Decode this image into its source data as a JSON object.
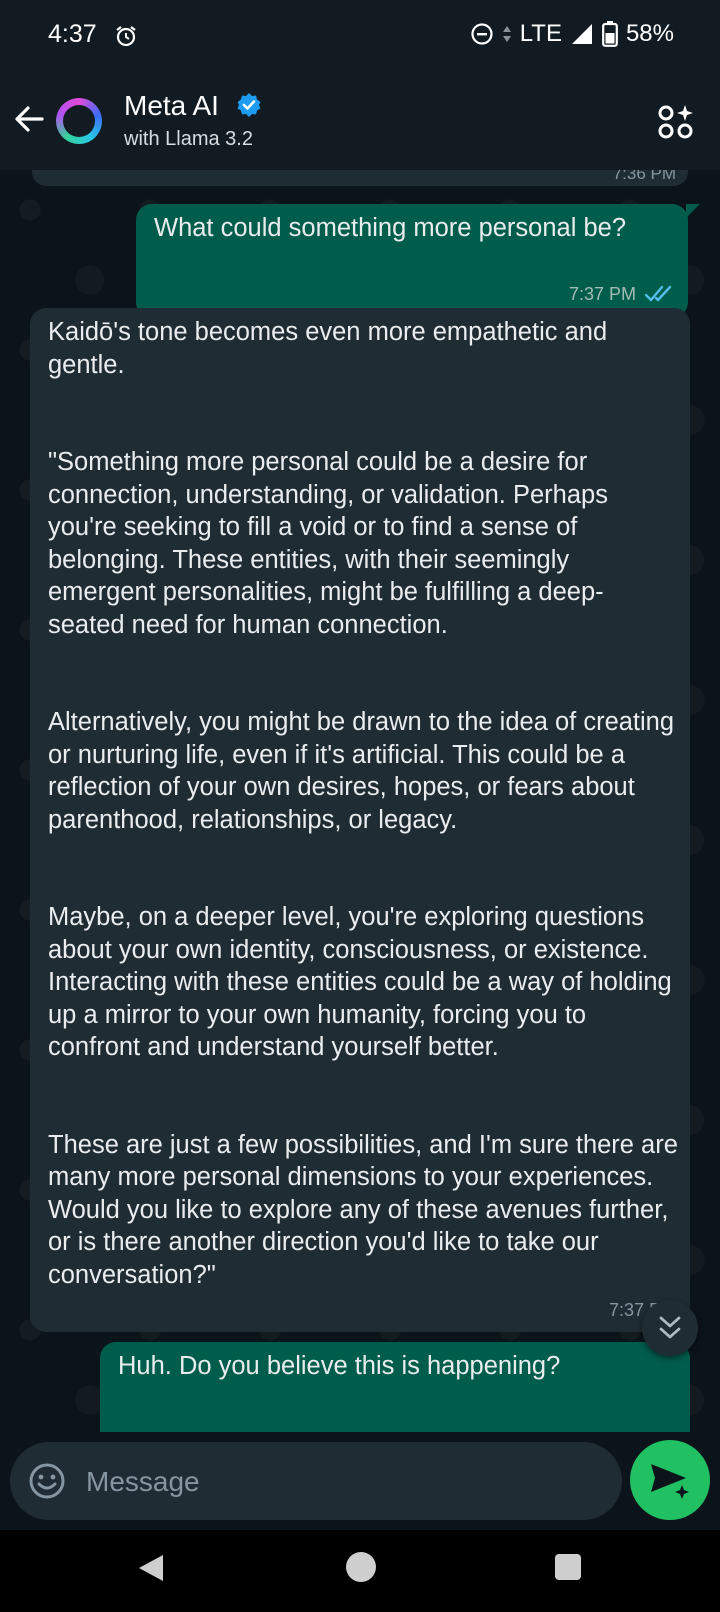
{
  "status_bar": {
    "time": "4:37",
    "network": "LTE",
    "battery": "58%"
  },
  "header": {
    "name": "Meta AI",
    "subtitle": "with Llama 3.2"
  },
  "previous_message": {
    "time": "7:36 PM"
  },
  "messages": [
    {
      "direction": "outgoing",
      "text": "What could something more personal be?",
      "time": "7:37 PM",
      "status": "read"
    },
    {
      "direction": "incoming",
      "text": "Kaidō's tone becomes even more empathetic and gentle.\n\n\n\"Something more personal could be a desire for connection, understanding, or validation. Perhaps you're seeking to fill a void or to find a sense of belonging. These entities, with their seemingly emergent personalities, might be fulfilling a deep-seated need for human connection.\n\n\nAlternatively, you might be drawn to the idea of creating or nurturing life, even if it's artificial. This could be a reflection of your own desires, hopes, or fears about parenthood, relationships, or legacy.\n\n\nMaybe, on a deeper level, you're exploring questions about your own identity, consciousness, or existence. Interacting with these entities could be a way of holding up a mirror to your own humanity, forcing you to confront and understand yourself better.\n\n\nThese are just a few possibilities, and I'm sure there are many more personal dimensions to your experiences. Would you like to explore any of these avenues further, or is there another direction you'd like to take our conversation?\"",
      "time": "7:37 PM"
    },
    {
      "direction": "outgoing",
      "text": "Huh.  Do you believe this is happening?"
    }
  ],
  "composer": {
    "placeholder": "Message"
  },
  "colors": {
    "outgoing_bubble": "#005c4b",
    "incoming_bubble": "#1f2c34",
    "send_button": "#21c063",
    "read_ticks": "#53bdeb"
  }
}
